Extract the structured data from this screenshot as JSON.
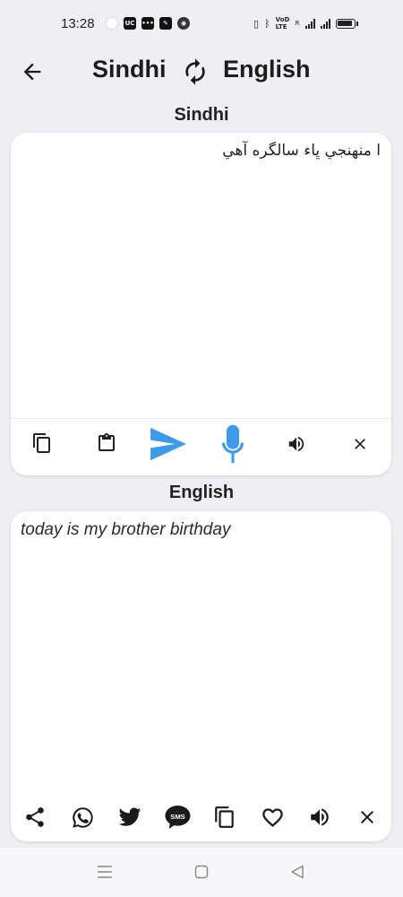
{
  "status_bar": {
    "time": "13:28",
    "network_label": "VoD LTE",
    "roaming_label": "R"
  },
  "header": {
    "source_language": "Sindhi",
    "target_language": "English"
  },
  "source_panel": {
    "title": "Sindhi",
    "text": "ا منهنجي ڀاء سالگره آهي",
    "actions": [
      "copy-icon",
      "clipboard-icon",
      "send-icon",
      "microphone-icon",
      "speaker-icon",
      "close-icon"
    ],
    "accent_color": "#3d9be9"
  },
  "target_panel": {
    "title": "English",
    "text": "today is my brother birthday",
    "actions": [
      "share-icon",
      "whatsapp-icon",
      "twitter-icon",
      "sms-icon",
      "copy-icon",
      "heart-icon",
      "speaker-icon",
      "close-icon"
    ]
  },
  "nav_bar": {
    "buttons": [
      "menu-icon",
      "home-icon",
      "back-icon"
    ]
  }
}
